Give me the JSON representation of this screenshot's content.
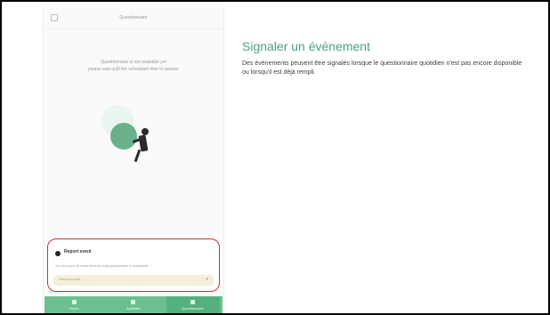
{
  "phone": {
    "header_title": "Questionnaire",
    "message_line1": "Questionnaire is not available yet",
    "message_line2": "please wait until the scheduled time to answer",
    "event_card_title": "Report event",
    "event_card_desc": "You can report an event when the daily questionnaire is unavailable",
    "event_field_placeholder": "Select an event",
    "bottom_nav": [
      "Home",
      "Activities",
      "Questionnaire"
    ]
  },
  "panel": {
    "title": "Signaler un évènement",
    "description": "Des événements peuvent être signalés lorsque le questionnaire quotidien n'est pas encore disponible ou lorsqu'il est déjà rempli."
  },
  "colors": {
    "accent_green": "#4aa37b",
    "nav_green": "#6cc08f",
    "highlight_red": "#d32f2f"
  }
}
